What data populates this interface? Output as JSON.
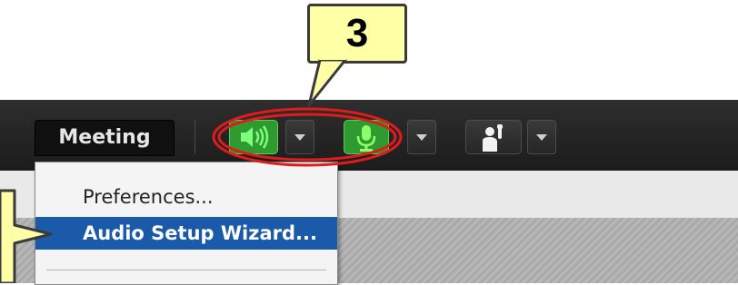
{
  "toolbar": {
    "meeting_label": "Meeting",
    "speaker_icon": "speaker-icon",
    "mic_icon": "microphone-icon",
    "raise_hand_icon": "raise-hand-icon",
    "active_color": "#2f9a2f"
  },
  "menu": {
    "items": [
      {
        "label": "Preferences..."
      },
      {
        "label": "Audio Setup Wizard...",
        "highlighted": true
      }
    ],
    "highlight_color": "#1b5aa8"
  },
  "callout": {
    "step_number": "3",
    "background": "#ffffa6"
  },
  "annotation": {
    "ellipse_color": "#e01b1b"
  }
}
